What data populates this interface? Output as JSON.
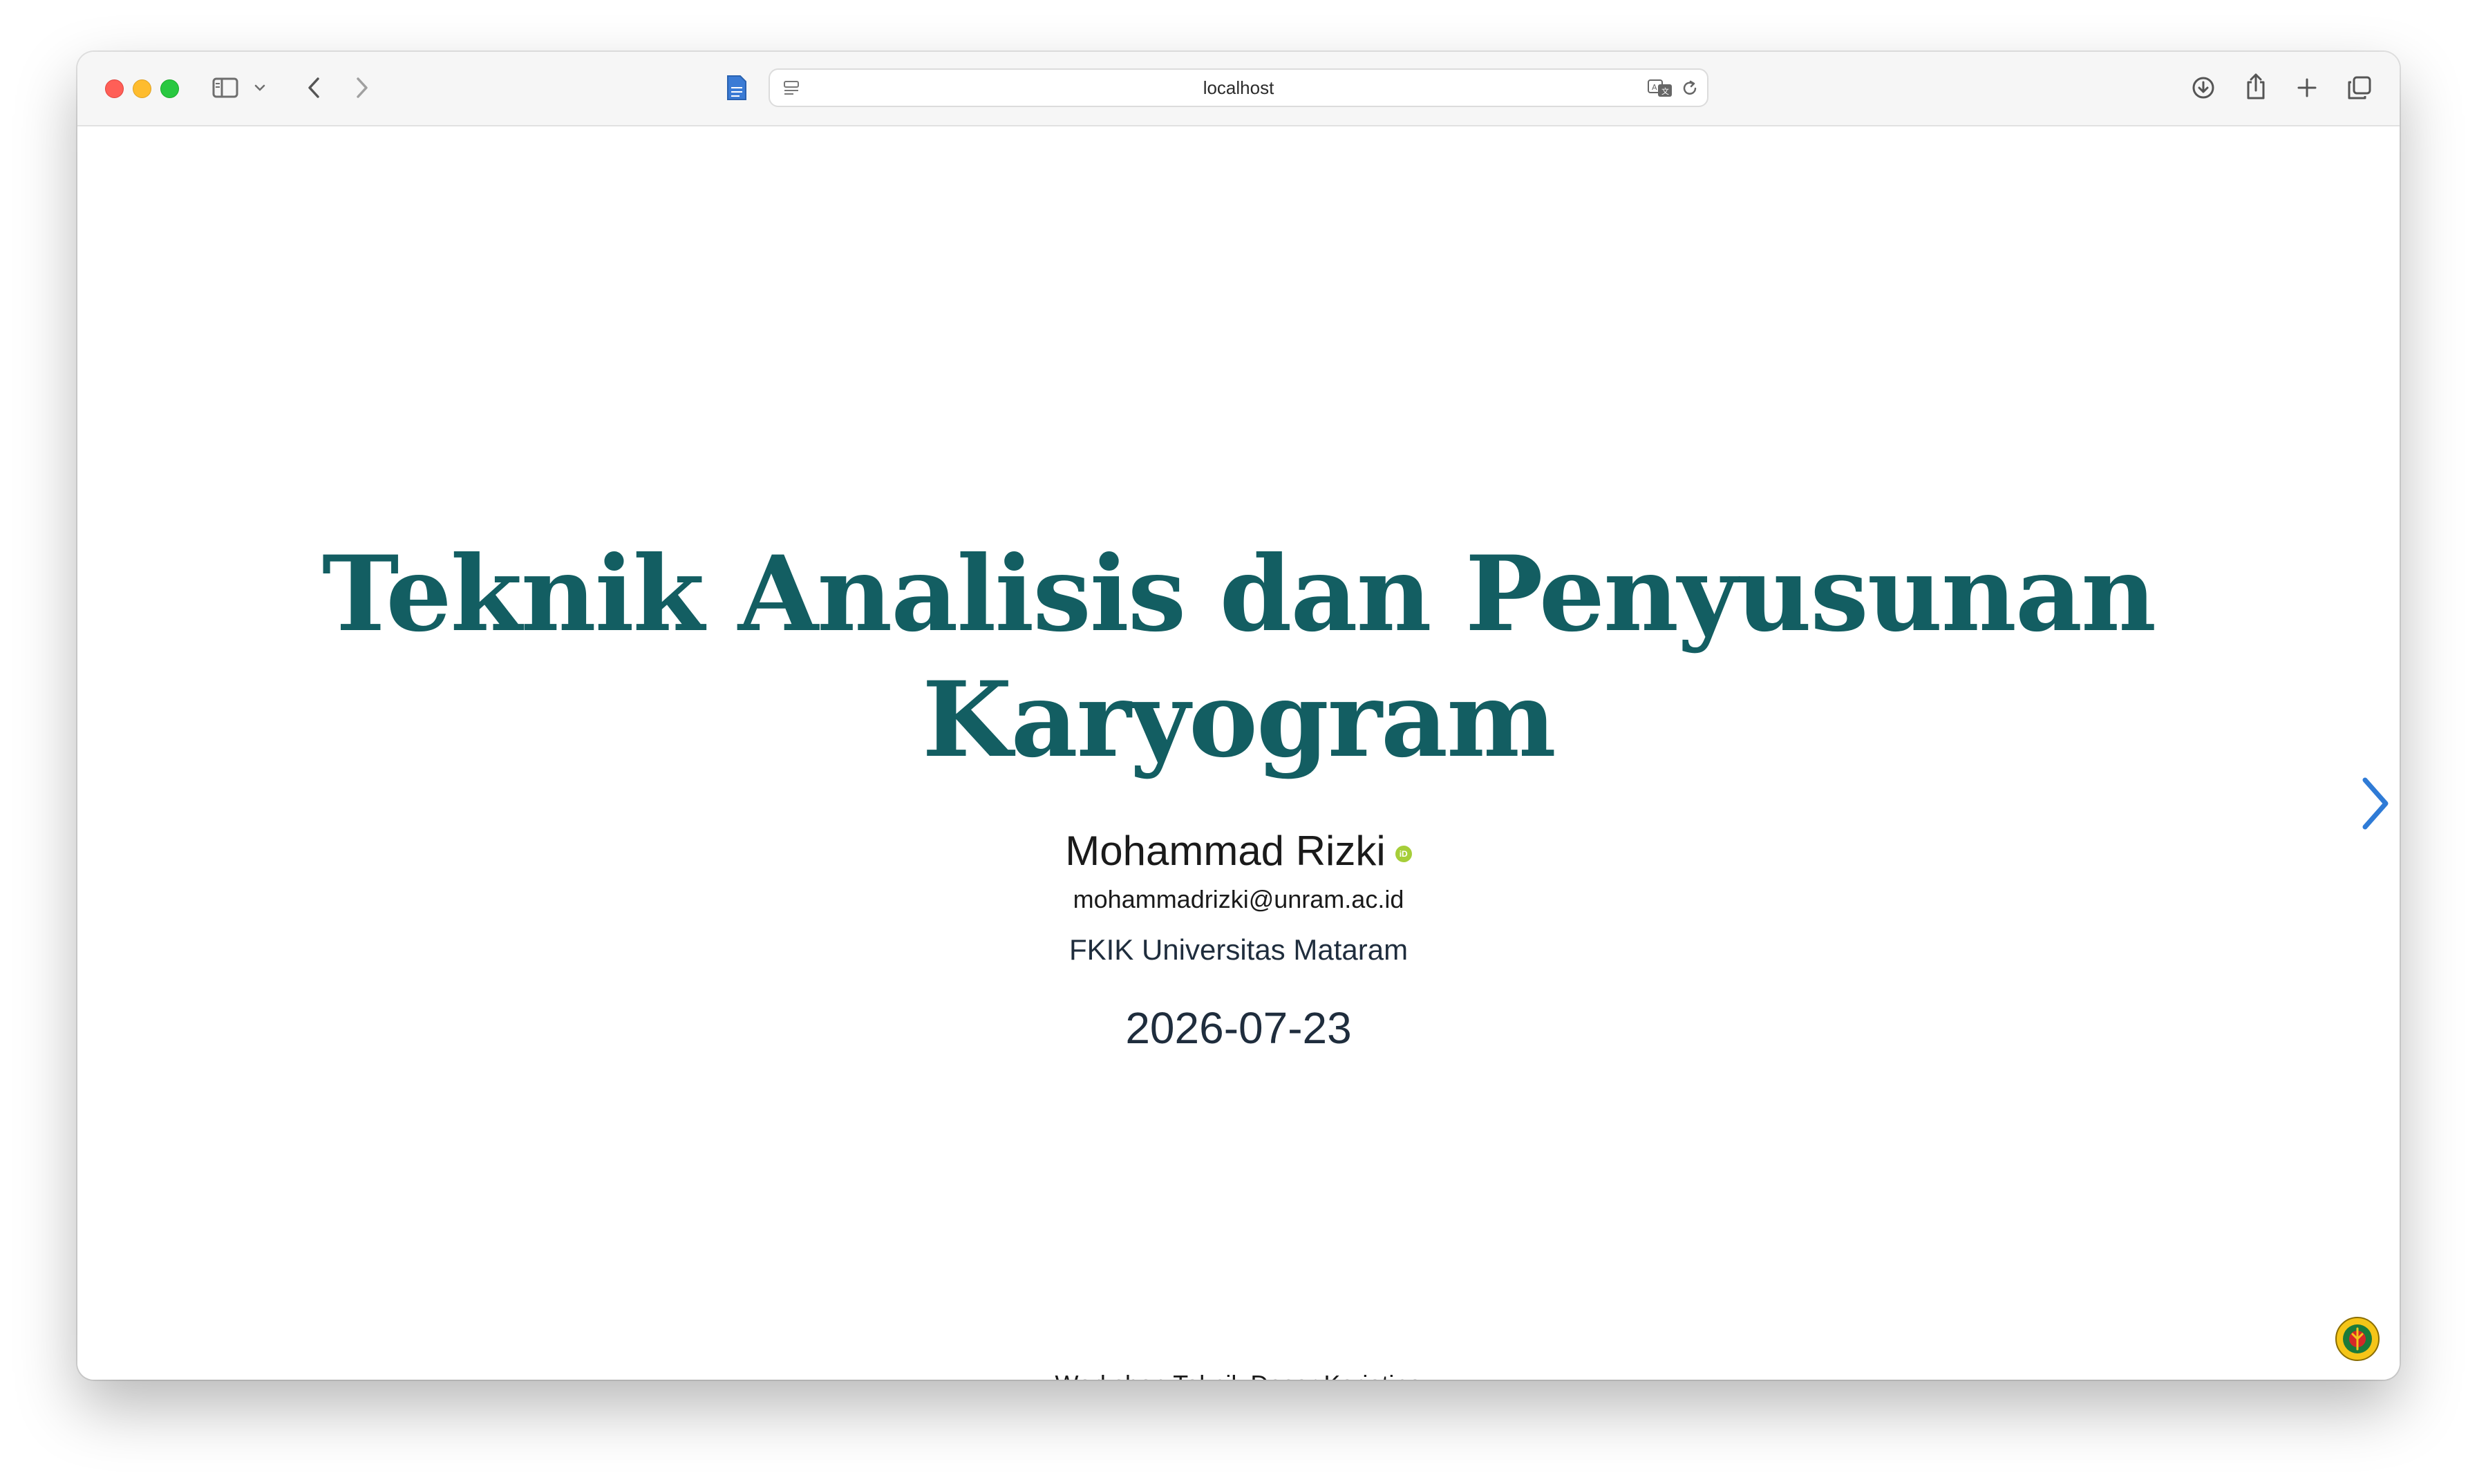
{
  "browser": {
    "url": "localhost",
    "icons": {
      "sidebar": "sidebar-icon",
      "back": "chevron-left-icon",
      "forward": "chevron-right-icon",
      "page": "document-icon",
      "reader": "reader-icon",
      "translate": "translate-icon",
      "reload": "reload-icon",
      "download": "download-icon",
      "share": "share-icon",
      "new_tab": "plus-icon",
      "tabs": "tabs-overview-icon"
    }
  },
  "slide": {
    "title_line1": "Teknik Analisis dan Penyusunan",
    "title_line2": "Karyogram",
    "author": "Mohammad Rizki",
    "orcid_label": "iD",
    "email": "mohammadrizki@unram.ac.id",
    "affiliation": "FKIK Universitas Mataram",
    "date": "2026-07-23",
    "footer": "Workshop Teknik Dasar Kariotipe"
  },
  "colors": {
    "title": "#135e62",
    "accent": "#2f7bd6",
    "orcid": "#a6ce39"
  }
}
